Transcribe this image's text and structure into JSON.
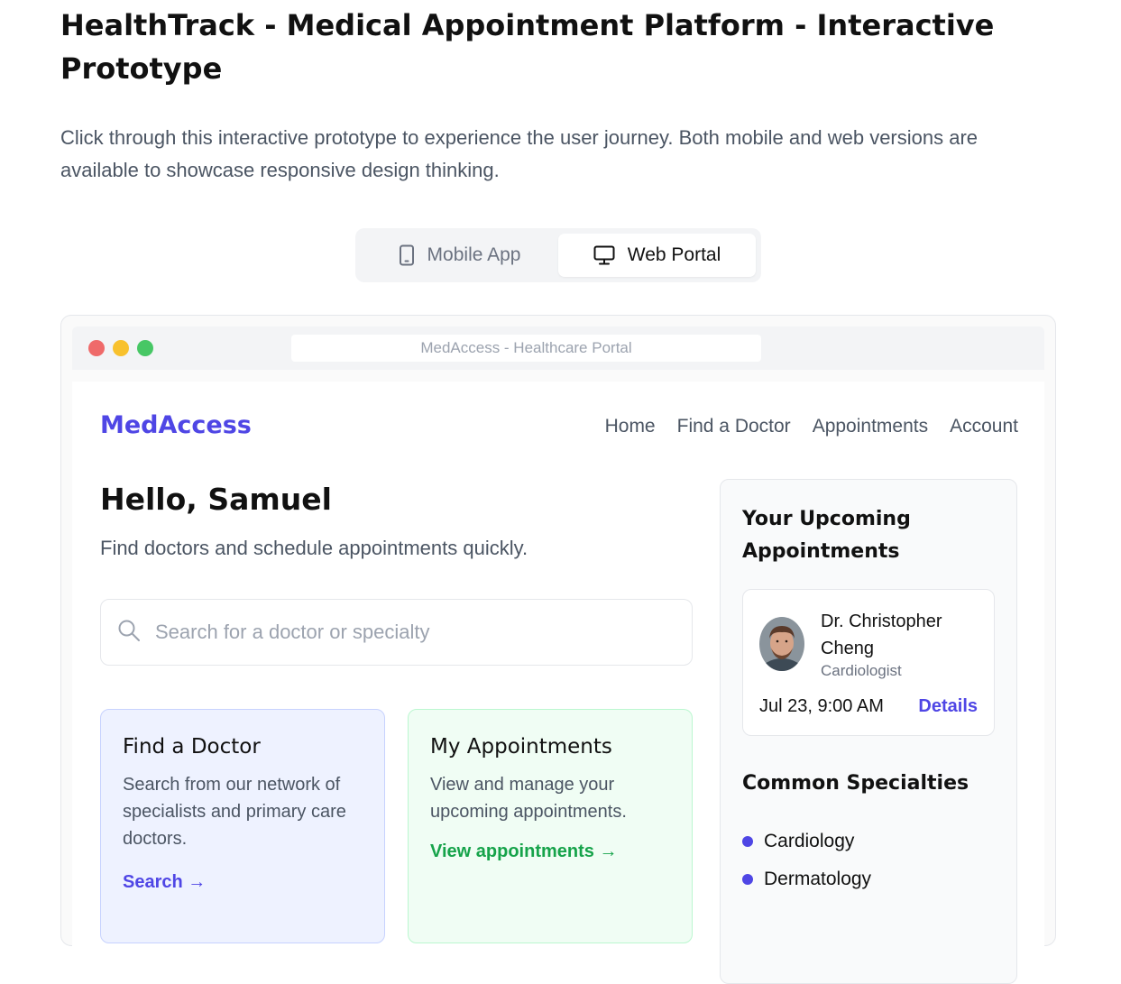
{
  "page": {
    "title": "HealthTrack - Medical Appointment Platform - Interactive Prototype",
    "intro": "Click through this interactive prototype to experience the user journey. Both mobile and web versions are available to showcase responsive design thinking."
  },
  "toggle": {
    "options": [
      {
        "label": "Mobile App",
        "icon": "smartphone-icon",
        "active": false
      },
      {
        "label": "Web Portal",
        "icon": "monitor-icon",
        "active": true
      }
    ]
  },
  "browser": {
    "address": "MedAccess - Healthcare Portal"
  },
  "portal": {
    "brand": "MedAccess",
    "nav": [
      "Home",
      "Find a Doctor",
      "Appointments",
      "Account"
    ],
    "greeting": "Hello, Samuel",
    "subtext": "Find doctors and schedule appointments quickly.",
    "search": {
      "placeholder": "Search for a doctor or specialty",
      "value": ""
    },
    "cards": [
      {
        "title": "Find a Doctor",
        "description": "Search from our network of specialists and primary care doctors.",
        "link": "Search →"
      },
      {
        "title": "My Appointments",
        "description": "View and manage your upcoming appointments.",
        "link": "View appointments →"
      }
    ],
    "sidebar": {
      "title": "Your Upcoming Appointments",
      "appointment": {
        "doctor": "Dr. Christopher Cheng",
        "specialty": "Cardiologist",
        "time": "Jul 23, 9:00 AM",
        "details": "Details"
      },
      "specialties_title": "Common Specialties",
      "specialties": [
        "Cardiology",
        "Dermatology"
      ]
    }
  },
  "colors": {
    "brand": "#4f46e5",
    "success": "#16a34a",
    "window_red": "#ef6a6a",
    "window_yellow": "#f8c12d",
    "window_green": "#47c765"
  }
}
